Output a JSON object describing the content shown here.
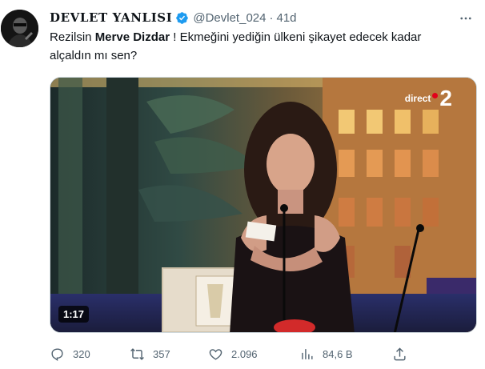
{
  "author": {
    "display_name": "DEVLET YANLISI",
    "handle": "@Devlet_024",
    "time": "41d",
    "verified_icon": "verified-badge-icon",
    "separator": "·"
  },
  "tweet": {
    "text_before": "Rezilsin ",
    "mention_bold": "Merve Dizdar",
    "text_after": " ! Ekmeğini yediğin ülkeni şikayet edecek kadar alçaldın mı sen?"
  },
  "media": {
    "channel_label": "direct",
    "channel_number": "2",
    "duration": "1:17"
  },
  "actions": {
    "replies": "320",
    "retweets": "357",
    "likes": "2.096",
    "views": "84,6 B"
  },
  "colors": {
    "verified": "#1d9bf0",
    "muted": "#536471",
    "text": "#0f1419"
  }
}
